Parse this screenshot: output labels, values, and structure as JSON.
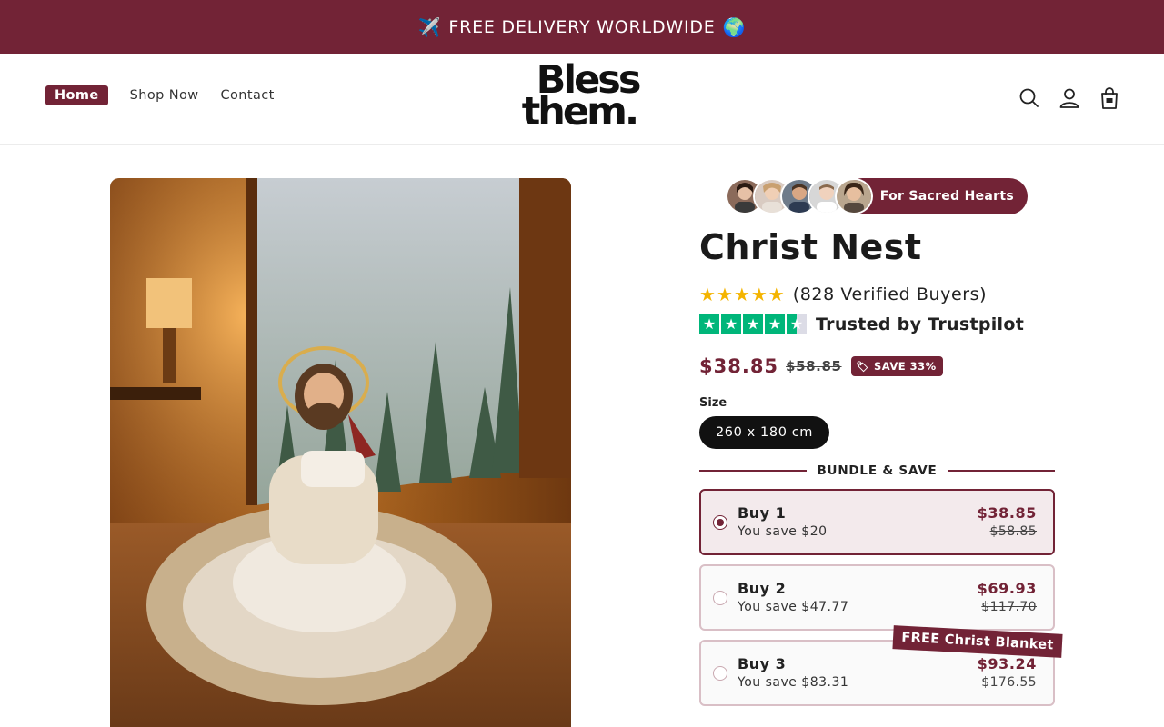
{
  "announcement": {
    "icon_left": "✈️",
    "text": "FREE DELIVERY WORLDWIDE",
    "icon_right": "🌍"
  },
  "header": {
    "nav": [
      {
        "label": "Home",
        "active": true
      },
      {
        "label": "Shop Now",
        "active": false
      },
      {
        "label": "Contact",
        "active": false
      }
    ],
    "logo_line1": "Bless",
    "logo_line2": "them.",
    "icons": [
      "search-icon",
      "account-icon",
      "cart-icon"
    ]
  },
  "product": {
    "badge_text": "For Sacred Hearts",
    "title": "Christ Nest",
    "rating_count_text": "(828 Verified Buyers)",
    "rating_stars": 5,
    "trust_text": "Trusted by Trustpilot",
    "trustpilot_stars": 4.5,
    "price_now": "$38.85",
    "price_was": "$58.85",
    "save_label": "SAVE 33%",
    "size_label": "Size",
    "size_value": "260 x 180 cm",
    "bundle_heading": "BUNDLE & SAVE",
    "bundles": [
      {
        "title": "Buy 1",
        "savings": "You save $20",
        "price": "$38.85",
        "compare": "$58.85",
        "selected": true
      },
      {
        "title": "Buy 2",
        "savings": "You save $47.77",
        "price": "$69.93",
        "compare": "$117.70",
        "selected": false
      },
      {
        "title": "Buy 3",
        "savings": "You save $83.31",
        "price": "$93.24",
        "compare": "$176.55",
        "selected": false
      }
    ],
    "bundle_ribbon": "FREE Christ Blanket"
  },
  "colors": {
    "brand": "#722336",
    "star_yellow": "#f4b400",
    "trustpilot_green": "#00b67a"
  }
}
